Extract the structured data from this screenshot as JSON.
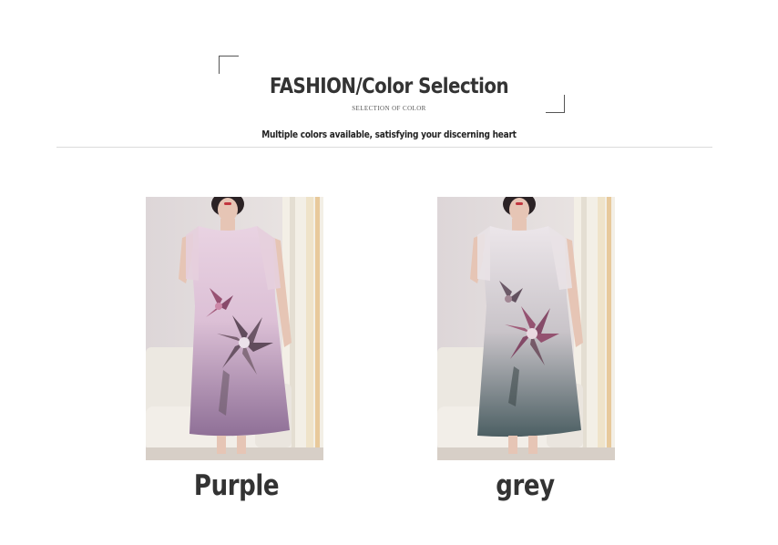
{
  "header": {
    "title": "FASHION/Color Selection",
    "subtitle": "SELECTION OF COLOR",
    "tagline": "Multiple colors available, satisfying your discerning heart"
  },
  "products": [
    {
      "color_name": "Purple",
      "dress_top": "#e9d3e2",
      "dress_bottom": "#8f7097"
    },
    {
      "color_name": "grey",
      "dress_top": "#ece6ea",
      "dress_bottom": "#4c5f63"
    }
  ],
  "colors": {
    "text": "#333333",
    "divider": "#dcdcdc",
    "background": "#ffffff"
  }
}
